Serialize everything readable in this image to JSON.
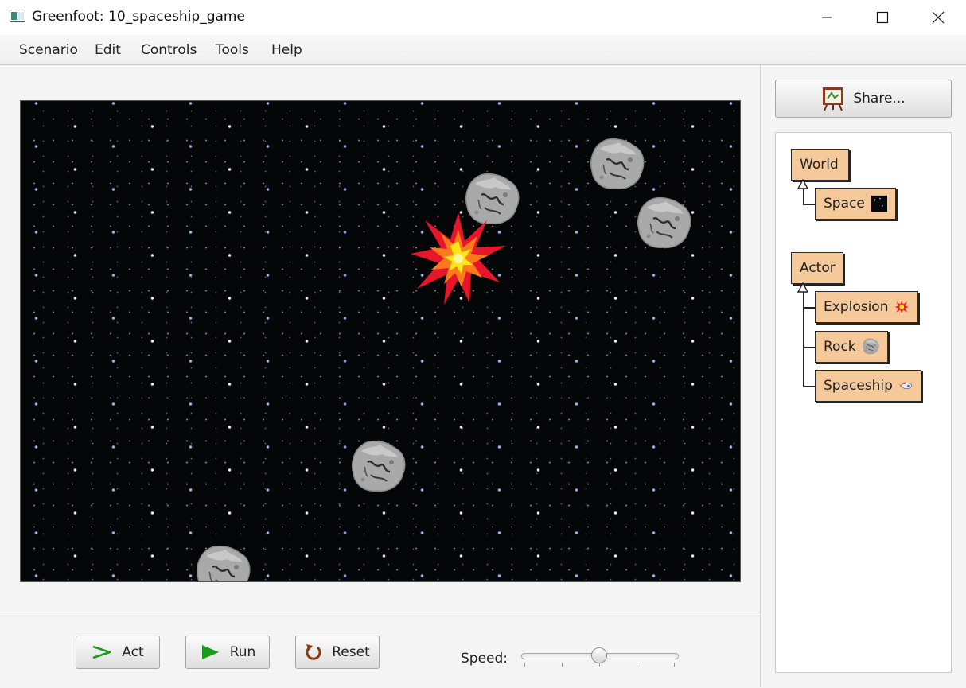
{
  "window": {
    "title": "Greenfoot: 10_spaceship_game"
  },
  "menu": {
    "items": [
      "Scenario",
      "Edit",
      "Controls",
      "Tools",
      "Help"
    ]
  },
  "world": {
    "name": "Space",
    "actors": [
      {
        "type": "Rock"
      },
      {
        "type": "Rock"
      },
      {
        "type": "Rock"
      },
      {
        "type": "Rock"
      },
      {
        "type": "Rock"
      },
      {
        "type": "Explosion"
      }
    ]
  },
  "controls": {
    "act_label": "Act",
    "run_label": "Run",
    "reset_label": "Reset",
    "speed_label": "Speed:",
    "speed_value": 0.5
  },
  "sidebar": {
    "share_label": "Share...",
    "class_tree": {
      "world_root": "World",
      "world_subclasses": [
        "Space"
      ],
      "actor_root": "Actor",
      "actor_subclasses": [
        "Explosion",
        "Rock",
        "Spaceship"
      ]
    }
  },
  "colors": {
    "class_box": "#f6c99b",
    "run_icon": "#1a9a1a",
    "reset_icon": "#8a3a10",
    "space_background": "#050608"
  }
}
